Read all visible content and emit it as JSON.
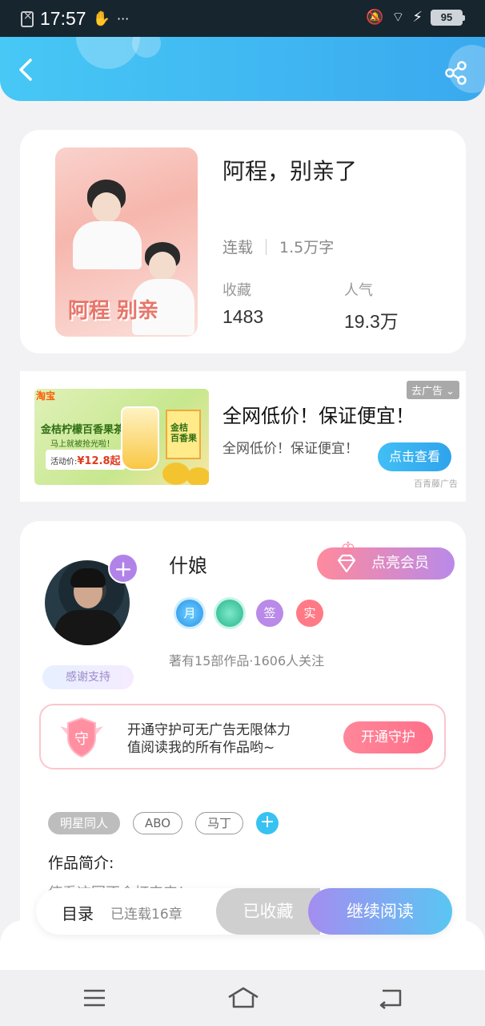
{
  "status_bar": {
    "time": "17:57",
    "battery": "95",
    "dots": "···"
  },
  "book": {
    "title": "阿程，别亲了",
    "status": "连载",
    "word_count": "1.5万字",
    "favorites_label": "收藏",
    "favorites_value": "1483",
    "popularity_label": "人气",
    "popularity_value": "19.3万",
    "cover_text": "阿程 别亲"
  },
  "ad": {
    "close_label": "去广告",
    "title": "全网低价！保证便宜！",
    "description": "全网低价！保证便宜！",
    "button_label": "点击查看",
    "source": "百青藤广告",
    "image": {
      "brand": "淘宝",
      "product": "金桔柠檬百香果茶",
      "slogan": "马上就被抢光啦！",
      "price_label": "活动价:",
      "price": "¥12.8起",
      "box_text": "金桔 百香果"
    }
  },
  "author": {
    "name": "什娘",
    "vip_button": "点亮会员",
    "badges": [
      "月",
      "",
      "签",
      "实"
    ],
    "stats": "著有15部作品·1606人关注",
    "thanks_label": "感谢支持",
    "guard_line1": "开通守护可无广告无限体力",
    "guard_line2": "值阅读我的所有作品哟~",
    "guard_icon_char": "守",
    "guard_button": "开通守护",
    "tags": [
      "明星同人",
      "ABO",
      "马丁"
    ],
    "intro_label": "作品简介:",
    "intro_text": "使看这回不会打来来！"
  },
  "action_bar": {
    "toc_label": "目录",
    "toc_count": "已连载16章",
    "favorited_label": "已收藏",
    "continue_label": "继续阅读"
  },
  "colors": {
    "header_start": "#47c8f5",
    "header_end": "#3aa9ef",
    "accent_blue": "#38c2f2",
    "vip_pink": "#ff8a9d",
    "vip_purple": "#b98ae8"
  }
}
